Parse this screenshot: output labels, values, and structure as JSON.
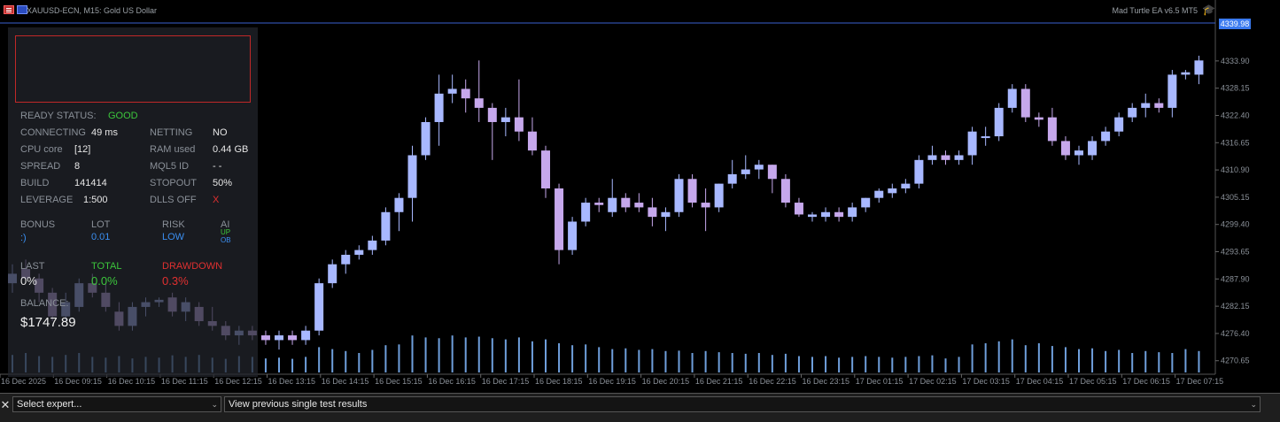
{
  "header": {
    "symbol": "XAUUSD-ECN, M15:  Gold US Dollar",
    "ea_label": "Mad Turtle EA v6.5 MT5",
    "current_price": "4339.98",
    "icons": [
      "menu-icon",
      "flag-icon",
      "hat-icon"
    ]
  },
  "panel": {
    "ready_label": "READY STATUS:",
    "ready_value": "GOOD",
    "connecting_label": "CONNECTING",
    "connecting_value": "49 ms",
    "netting_label": "NETTING",
    "netting_value": "NO",
    "cpu_label": "CPU core",
    "cpu_value": "[12]",
    "ram_label": "RAM used",
    "ram_value": "0.44 GB",
    "spread_label": "SPREAD",
    "spread_value": "8",
    "mql5_label": "MQL5 ID",
    "mql5_value": "- -",
    "build_label": "BUILD",
    "build_value": "141414",
    "stopout_label": "STOPOUT",
    "stopout_value": "50%",
    "leverage_label": "LEVERAGE",
    "leverage_value": "1:500",
    "dlls_label": "DLLS OFF",
    "dlls_value": "X",
    "bonus_label": "BONUS",
    "bonus_value": ":)",
    "lot_label": "LOT",
    "lot_value": "0.01",
    "risk_label": "RISK",
    "risk_value": "LOW",
    "ai_label": "AI",
    "ai_up": "UP",
    "ai_ob": "OB",
    "last_label": "LAST",
    "last_value": "0%",
    "total_label": "TOTAL",
    "total_value": "0.0%",
    "drawdown_label": "DRAWDOWN",
    "drawdown_value": "0.3%",
    "balance_label": "BALANCE:",
    "balance_value": "$1747.89"
  },
  "bottom": {
    "expert_select": "Select expert...",
    "results_select": "View previous single test results"
  },
  "colors": {
    "bull": "#a8b8ff",
    "bear": "#c6a8ec",
    "volume": "#6f9fdc",
    "axis": "#8a9098",
    "grid_line": "#3a5fd0"
  },
  "chart_data": {
    "type": "candlestick",
    "y_ticks": [
      "4270.65",
      "4276.40",
      "4282.15",
      "4287.90",
      "4293.65",
      "4299.40",
      "4305.15",
      "4310.90",
      "4316.65",
      "4322.40",
      "4328.15",
      "4333.90"
    ],
    "y_tick_values": [
      4270.65,
      4276.4,
      4282.15,
      4287.9,
      4293.65,
      4299.4,
      4305.15,
      4310.9,
      4316.65,
      4322.4,
      4328.15,
      4333.9
    ],
    "ylim": [
      4267.8,
      4341.9
    ],
    "x_ticks": [
      "16 Dec 2025",
      "16 Dec 09:15",
      "16 Dec 10:15",
      "16 Dec 11:15",
      "16 Dec 12:15",
      "16 Dec 13:15",
      "16 Dec 14:15",
      "16 Dec 15:15",
      "16 Dec 16:15",
      "16 Dec 17:15",
      "16 Dec 18:15",
      "16 Dec 19:15",
      "16 Dec 20:15",
      "16 Dec 21:15",
      "16 Dec 22:15",
      "16 Dec 23:15",
      "17 Dec 01:15",
      "17 Dec 02:15",
      "17 Dec 03:15",
      "17 Dec 04:15",
      "17 Dec 05:15",
      "17 Dec 06:15",
      "17 Dec 07:15"
    ],
    "candles": [
      [
        4287,
        4291,
        4285,
        4289
      ],
      [
        4290,
        4292,
        4287,
        4288
      ],
      [
        4288,
        4289,
        4283,
        4285
      ],
      [
        4285,
        4286,
        4279,
        4280
      ],
      [
        4280,
        4285,
        4279,
        4283
      ],
      [
        4282,
        4288,
        4281,
        4287
      ],
      [
        4287,
        4289,
        4284,
        4285
      ],
      [
        4285,
        4287,
        4281,
        4282
      ],
      [
        4281,
        4283,
        4277,
        4278
      ],
      [
        4278,
        4283,
        4277,
        4282
      ],
      [
        4282,
        4284,
        4280,
        4283
      ],
      [
        4283,
        4284,
        4282,
        4283.5
      ],
      [
        4284,
        4285,
        4280,
        4281
      ],
      [
        4281,
        4284,
        4279,
        4283
      ],
      [
        4282,
        4283,
        4278,
        4279
      ],
      [
        4279,
        4282,
        4277,
        4278
      ],
      [
        4278,
        4279,
        4275,
        4276
      ],
      [
        4276,
        4278,
        4274,
        4277
      ],
      [
        4277,
        4278,
        4275,
        4276
      ],
      [
        4276,
        4277,
        4274,
        4275
      ],
      [
        4275,
        4277,
        4273,
        4276
      ],
      [
        4276,
        4277,
        4274,
        4275
      ],
      [
        4275,
        4278,
        4274,
        4277
      ],
      [
        4277,
        4288,
        4276,
        4287
      ],
      [
        4287,
        4292,
        4286,
        4291
      ],
      [
        4291,
        4294,
        4289,
        4293
      ],
      [
        4293,
        4295,
        4292,
        4294
      ],
      [
        4294,
        4297,
        4293,
        4296
      ],
      [
        4296,
        4303,
        4295,
        4302
      ],
      [
        4302,
        4306,
        4298,
        4305
      ],
      [
        4305,
        4316,
        4300,
        4314
      ],
      [
        4314,
        4322,
        4313,
        4321
      ],
      [
        4321,
        4331,
        4316,
        4327
      ],
      [
        4327,
        4331,
        4325,
        4328
      ],
      [
        4328,
        4330,
        4323,
        4326
      ],
      [
        4326,
        4334,
        4321,
        4324
      ],
      [
        4324,
        4325,
        4313,
        4321
      ],
      [
        4321,
        4324,
        4318,
        4322
      ],
      [
        4322,
        4330,
        4317,
        4319
      ],
      [
        4319,
        4322,
        4314,
        4315
      ],
      [
        4315,
        4316,
        4305,
        4307
      ],
      [
        4307,
        4308,
        4291,
        4294
      ],
      [
        4294,
        4301,
        4293,
        4300
      ],
      [
        4300,
        4305,
        4299,
        4304
      ],
      [
        4304,
        4305,
        4302,
        4303.5
      ],
      [
        4302,
        4309,
        4301,
        4305
      ],
      [
        4305,
        4306,
        4302,
        4303
      ],
      [
        4304,
        4306,
        4302,
        4303
      ],
      [
        4303,
        4305,
        4299,
        4301
      ],
      [
        4301,
        4303,
        4298,
        4302
      ],
      [
        4302,
        4310,
        4301,
        4309
      ],
      [
        4309,
        4310,
        4303,
        4304
      ],
      [
        4304,
        4307,
        4298,
        4303
      ],
      [
        4303,
        4308,
        4302,
        4308
      ],
      [
        4308,
        4313,
        4307,
        4310
      ],
      [
        4310,
        4314,
        4309,
        4311
      ],
      [
        4311,
        4313,
        4309,
        4312
      ],
      [
        4312,
        4312,
        4306,
        4309
      ],
      [
        4309,
        4310,
        4303,
        4304
      ],
      [
        4304,
        4305,
        4301,
        4301.5
      ],
      [
        4301,
        4302,
        4300,
        4301.5
      ],
      [
        4301,
        4303,
        4300,
        4302
      ],
      [
        4302,
        4303,
        4300,
        4301
      ],
      [
        4301,
        4304,
        4300,
        4303
      ],
      [
        4303,
        4305,
        4302,
        4305
      ],
      [
        4305,
        4307,
        4304,
        4306.5
      ],
      [
        4306,
        4308,
        4305,
        4307
      ],
      [
        4307,
        4309,
        4306,
        4308
      ],
      [
        4308,
        4314,
        4307,
        4313
      ],
      [
        4313,
        4316,
        4312,
        4314
      ],
      [
        4314,
        4315,
        4312,
        4313
      ],
      [
        4313,
        4315,
        4312,
        4314
      ],
      [
        4314,
        4320,
        4312,
        4319
      ],
      [
        4318,
        4320,
        4316,
        4318
      ],
      [
        4318,
        4325,
        4317,
        4324
      ],
      [
        4324,
        4329,
        4323,
        4328
      ],
      [
        4328,
        4329,
        4321,
        4322
      ],
      [
        4322,
        4323,
        4320,
        4321.5
      ],
      [
        4322,
        4324,
        4316,
        4317
      ],
      [
        4317,
        4318,
        4313,
        4314
      ],
      [
        4314,
        4316,
        4312,
        4315
      ],
      [
        4314,
        4318,
        4313,
        4317
      ],
      [
        4317,
        4320,
        4316,
        4319
      ],
      [
        4319,
        4323,
        4318,
        4322
      ],
      [
        4322,
        4325,
        4321,
        4324
      ],
      [
        4324,
        4327,
        4322,
        4325
      ],
      [
        4325,
        4326,
        4323,
        4324
      ],
      [
        4324,
        4332,
        4322,
        4331
      ],
      [
        4331,
        4332,
        4330,
        4331.5
      ],
      [
        4331,
        4335,
        4329,
        4334
      ],
      [
        4334,
        4338,
        4330,
        4333
      ],
      [
        4333,
        4341,
        4332,
        4340
      ],
      [
        4340,
        4343,
        4339,
        4342
      ]
    ],
    "volume_relative": [
      0.45,
      0.5,
      0.42,
      0.4,
      0.45,
      0.5,
      0.4,
      0.38,
      0.42,
      0.36,
      0.4,
      0.38,
      0.44,
      0.4,
      0.45,
      0.38,
      0.35,
      0.42,
      0.4,
      0.36,
      0.38,
      0.35,
      0.4,
      0.65,
      0.6,
      0.55,
      0.5,
      0.58,
      0.7,
      0.72,
      0.95,
      0.9,
      0.88,
      0.95,
      0.9,
      0.92,
      0.88,
      0.85,
      0.9,
      0.8,
      0.85,
      0.75,
      0.7,
      0.72,
      0.65,
      0.6,
      0.62,
      0.58,
      0.6,
      0.55,
      0.56,
      0.5,
      0.55,
      0.52,
      0.5,
      0.48,
      0.5,
      0.45,
      0.48,
      0.42,
      0.4,
      0.42,
      0.38,
      0.4,
      0.42,
      0.4,
      0.38,
      0.4,
      0.42,
      0.44,
      0.36,
      0.4,
      0.72,
      0.75,
      0.8,
      0.85,
      0.7,
      0.75,
      0.68,
      0.65,
      0.6,
      0.62,
      0.55,
      0.58,
      0.5,
      0.55,
      0.52,
      0.5,
      0.6,
      0.55,
      0.72,
      0.35,
      0.2
    ]
  }
}
